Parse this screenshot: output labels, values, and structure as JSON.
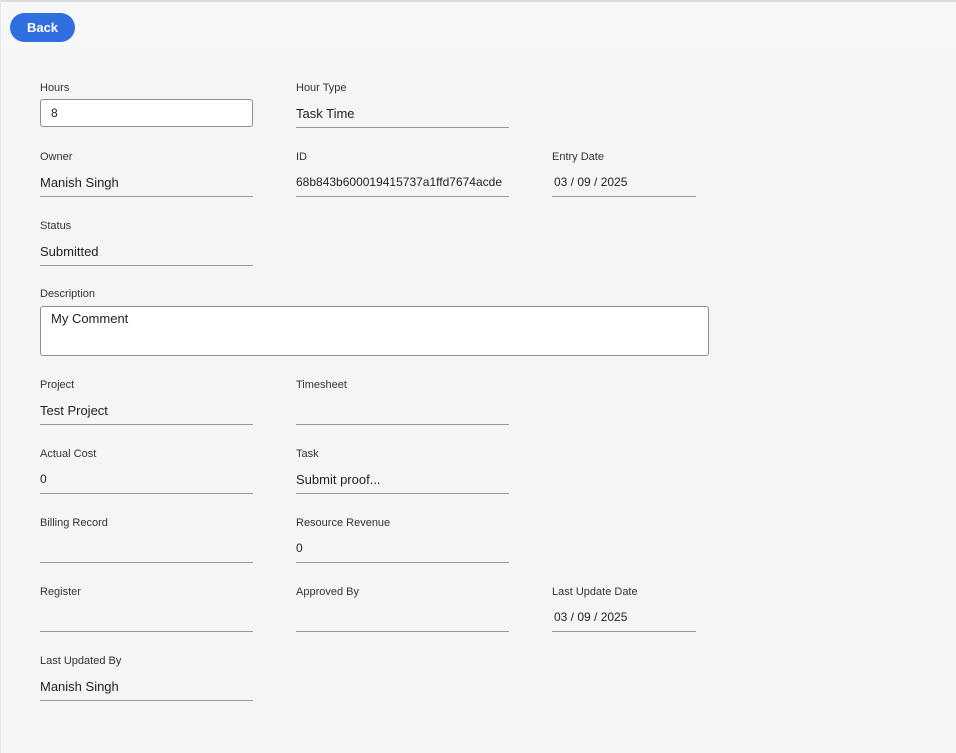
{
  "header": {
    "back_label": "Back"
  },
  "fields": {
    "hours": {
      "label": "Hours",
      "value": "8"
    },
    "hour_type": {
      "label": "Hour Type",
      "value": "Task Time"
    },
    "owner": {
      "label": "Owner",
      "value": "Manish Singh"
    },
    "id": {
      "label": "ID",
      "value": "68b843b600019415737a1ffd7674acde"
    },
    "entry_date": {
      "label": "Entry Date",
      "value": "03 / 09 / 2025"
    },
    "status": {
      "label": "Status",
      "value": "Submitted"
    },
    "description": {
      "label": "Description",
      "value": "My Comment"
    },
    "project": {
      "label": "Project",
      "value": "Test Project"
    },
    "timesheet": {
      "label": "Timesheet",
      "value": ""
    },
    "actual_cost": {
      "label": "Actual Cost",
      "value": "0"
    },
    "task": {
      "label": "Task",
      "value": "Submit proof..."
    },
    "billing_record": {
      "label": "Billing Record",
      "value": ""
    },
    "resource_revenue": {
      "label": "Resource Revenue",
      "value": "0"
    },
    "register": {
      "label": "Register",
      "value": ""
    },
    "approved_by": {
      "label": "Approved By",
      "value": ""
    },
    "last_update_date": {
      "label": "Last Update Date",
      "value": "03 / 09 / 2025"
    },
    "last_updated_by": {
      "label": "Last Updated By",
      "value": "Manish Singh"
    }
  },
  "colors": {
    "accent": "#2f6fe0",
    "background": "#f5f5f5"
  }
}
